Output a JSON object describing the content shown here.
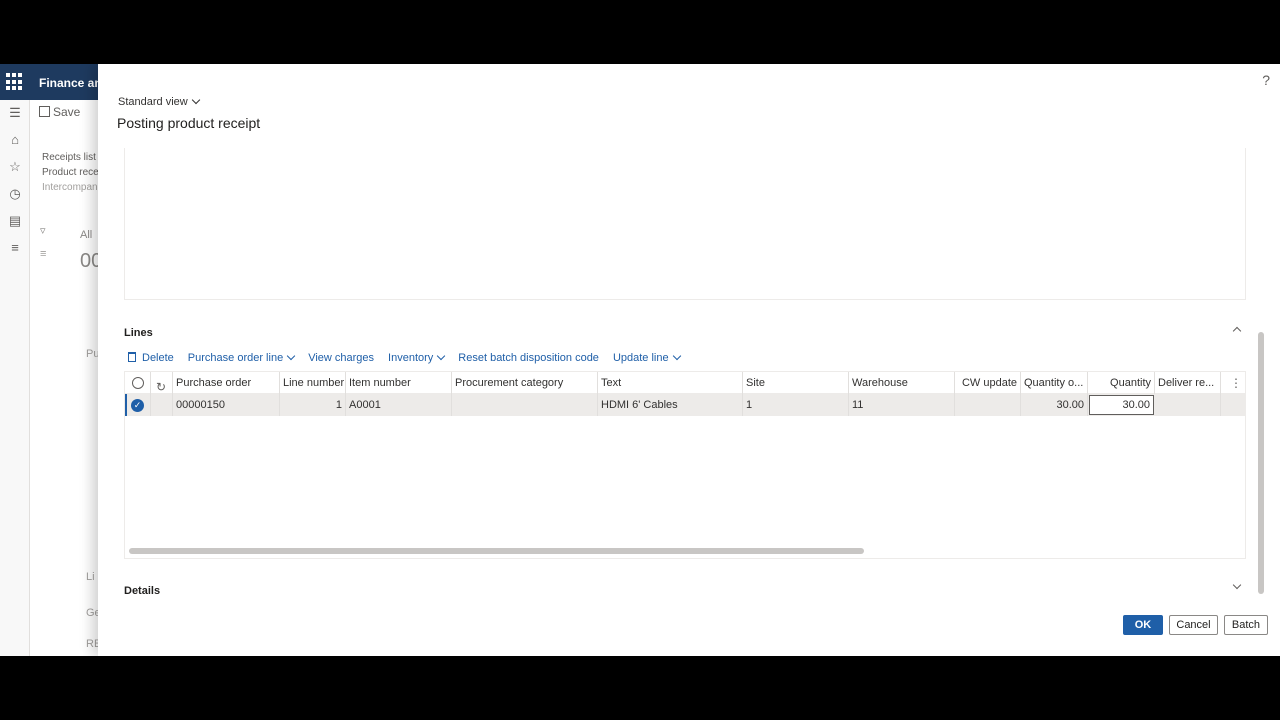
{
  "app": {
    "title": "Finance and"
  },
  "background": {
    "save_label": "Save",
    "links": [
      "Receipts list",
      "Product rece",
      "Intercompan"
    ],
    "all_label": "All",
    "big_value": "00",
    "pu_label": "Pu",
    "li_label": "Li",
    "ge_label": "Ge",
    "re_label": "RE"
  },
  "dialog": {
    "view_selector": "Standard view",
    "title": "Posting product receipt",
    "help_icon": "?",
    "lines_section": {
      "title": "Lines"
    },
    "details_section": {
      "title": "Details"
    },
    "toolbar": {
      "delete": "Delete",
      "purchase_order_line": "Purchase order line",
      "view_charges": "View charges",
      "inventory": "Inventory",
      "reset_batch": "Reset batch disposition code",
      "update_line": "Update line"
    },
    "grid": {
      "headers": {
        "purchase_order": "Purchase order",
        "line_number": "Line number",
        "item_number": "Item number",
        "procurement_category": "Procurement category",
        "text": "Text",
        "site": "Site",
        "warehouse": "Warehouse",
        "cw_update": "CW update",
        "quantity_o": "Quantity o...",
        "quantity": "Quantity",
        "deliver_re": "Deliver re..."
      },
      "rows": [
        {
          "purchase_order": "00000150",
          "line_number": "1",
          "item_number": "A0001",
          "procurement_category": "",
          "text": "HDMI 6' Cables",
          "site": "1",
          "warehouse": "11",
          "cw_update": "",
          "quantity_o": "30.00",
          "quantity": "30.00",
          "deliver_re": ""
        }
      ]
    },
    "buttons": {
      "ok": "OK",
      "cancel": "Cancel",
      "batch": "Batch"
    }
  },
  "colors": {
    "accent": "#1f5fa8",
    "appbar": "#1e3a5f"
  },
  "icons": [
    "waffle-icon",
    "menu-icon",
    "home-icon",
    "star-icon",
    "clock-icon",
    "workspace-icon",
    "list-icon",
    "filter-icon",
    "help-icon",
    "trash-icon",
    "refresh-icon",
    "more-icon"
  ]
}
